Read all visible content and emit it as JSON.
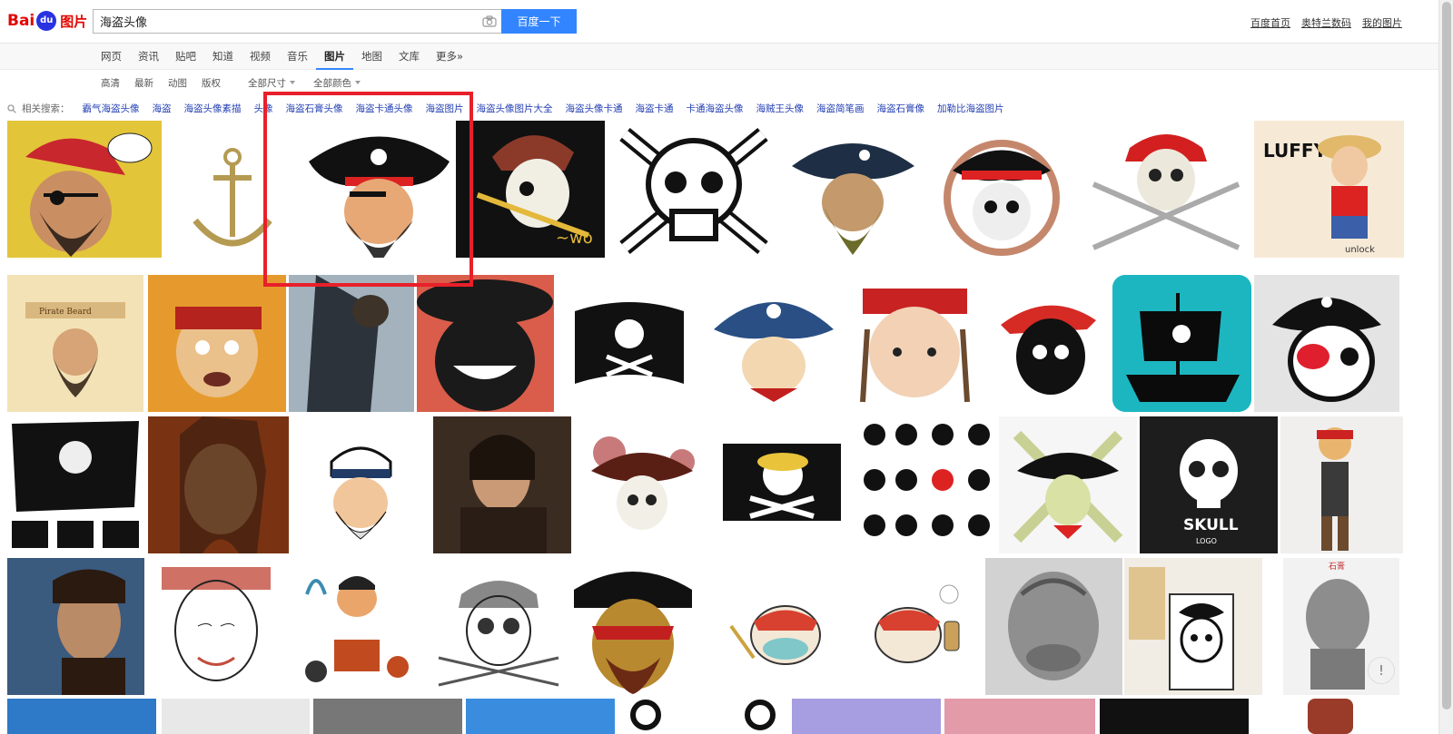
{
  "header": {
    "logo_text": "Bai",
    "logo_paw": "du",
    "logo_cn": "图片",
    "search_value": "海盗头像",
    "search_button": "百度一下",
    "links": [
      "百度首页",
      "奥特兰数码",
      "我的图片"
    ]
  },
  "nav": {
    "tabs": [
      "网页",
      "资讯",
      "贴吧",
      "知道",
      "视频",
      "音乐",
      "图片",
      "地图",
      "文库",
      "更多»"
    ],
    "active": "图片"
  },
  "filters": [
    "高清",
    "最新",
    "动图",
    "版权",
    "全部尺寸",
    "全部颜色"
  ],
  "related": {
    "label": "相关搜索：",
    "items": [
      "霸气海盗头像",
      "海盗",
      "海盗头像素描",
      "头像",
      "海盗石膏头像",
      "海盗卡通头像",
      "海盗图片",
      "海盗头像图片大全",
      "海盗头像卡通",
      "海盗卡通",
      "卡通海盗头像",
      "海贼王头像",
      "海盗简笔画",
      "海盗石膏像",
      "加勒比海盗图片"
    ]
  },
  "images": {
    "row1": [
      "pirate-yarg-cartoon",
      "anchor",
      "pirate-captain-cartoon",
      "skull-swords-black",
      "skull-crossbones",
      "bearded-pirate",
      "skull-ship-wheel",
      "skull-red-bandana-swords",
      "luffy-unlock"
    ],
    "row2": [
      "pirate-beard-vintage",
      "cartoon-sparrow",
      "jack-sparrow-sea",
      "straw-hat-pirate",
      "pirate-flag-icon",
      "pirate-parrot-knife",
      "cartoon-captain-jack",
      "skull-red-bandana",
      "pirate-ship-teal",
      "skull-eyepatch"
    ],
    "row3": [
      "jolly-roger-flags",
      "jack-sparrow-portrait",
      "sailor-captain",
      "johnny-depp",
      "skull-hat-splatter",
      "straw-hat-flag",
      "pirate-icon-set",
      "skull-crossbones-green",
      "skull-logo",
      "jack-sparrow-figure"
    ],
    "row4": [
      "jack-sparrow-boat",
      "sketch-sparrow",
      "pirate-elements",
      "sketch-skull-bandana",
      "pirate-face-mask",
      "cat-bandana-sword",
      "cat-bandana-bottle",
      "plaster-head",
      "skull-shirt",
      "plaster-bust"
    ],
    "row5": [
      "blue-tile",
      "gray-tile",
      "bw-portrait",
      "blue-sign",
      "bones-tile",
      "purple-tile",
      "pink-tile",
      "black-tile",
      "brown-tile"
    ]
  },
  "feedback_icon": "!"
}
